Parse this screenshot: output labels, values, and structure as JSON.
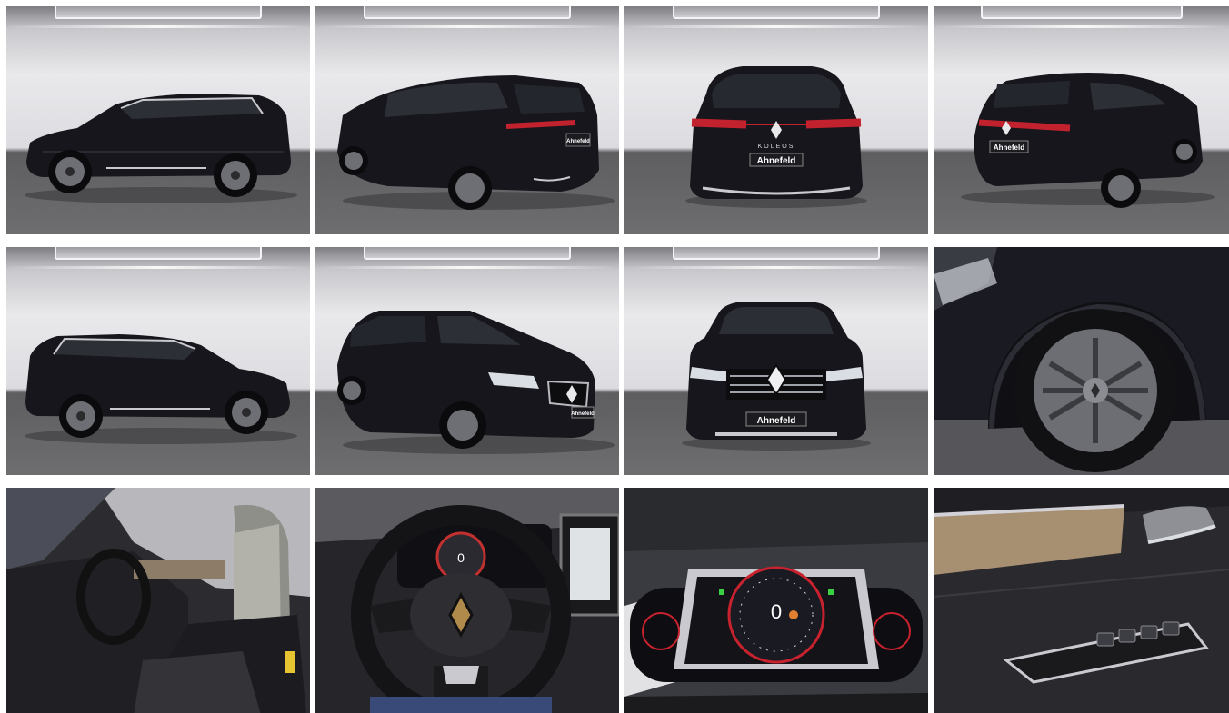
{
  "gallery": {
    "images": [
      {
        "id": 1,
        "view": "side-left"
      },
      {
        "id": 2,
        "view": "rear-three-quarter-left"
      },
      {
        "id": 3,
        "view": "rear"
      },
      {
        "id": 4,
        "view": "rear-three-quarter-right"
      },
      {
        "id": 5,
        "view": "side-right"
      },
      {
        "id": 6,
        "view": "front-three-quarter-left"
      },
      {
        "id": 7,
        "view": "front"
      },
      {
        "id": 8,
        "view": "wheel-closeup"
      },
      {
        "id": 9,
        "view": "interior-seats"
      },
      {
        "id": 10,
        "view": "steering-wheel"
      },
      {
        "id": 11,
        "view": "instrument-cluster"
      },
      {
        "id": 12,
        "view": "door-panel"
      }
    ],
    "plates": {
      "rear_badge": "KOLEOS",
      "rear_plate": "Ahnefeld",
      "front_plate": "Ahnefeld",
      "side_plate": "Ahnefeld",
      "speed": "0"
    },
    "colors": {
      "car_body": "#16161c",
      "studio_floor": "#656567",
      "studio_wall": "#e6e6e9",
      "tail_light": "#c2222e",
      "chrome": "#c9c9cf"
    }
  }
}
